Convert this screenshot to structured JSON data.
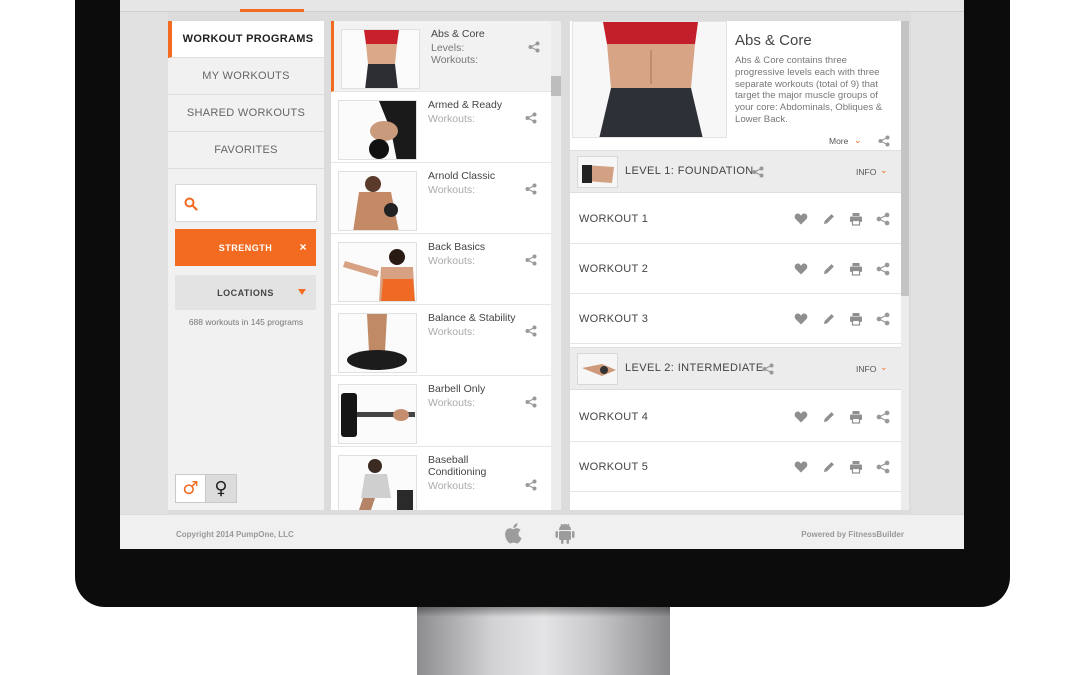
{
  "nav": {
    "items": [
      {
        "label": "WORKOUT PROGRAMS",
        "active": true
      },
      {
        "label": "MY WORKOUTS",
        "active": false
      },
      {
        "label": "SHARED WORKOUTS",
        "active": false
      },
      {
        "label": "FAVORITES",
        "active": false
      }
    ]
  },
  "filters": {
    "search_placeholder": "",
    "active_filter": "STRENGTH",
    "active_filter_close": "×",
    "locations_label": "LOCATIONS",
    "count_text": "688 workouts in 145 programs",
    "gender_male": "♂",
    "gender_female": "♀"
  },
  "programs": [
    {
      "title": "Abs & Core",
      "sub1": "Levels:",
      "sub2": "Workouts:",
      "selected": true
    },
    {
      "title": "Armed & Ready",
      "sub1": "Workouts:",
      "selected": false
    },
    {
      "title": "Arnold Classic",
      "sub1": "Workouts:",
      "selected": false
    },
    {
      "title": "Back Basics",
      "sub1": "Workouts:",
      "selected": false
    },
    {
      "title": "Balance & Stability",
      "sub1": "Workouts:",
      "selected": false
    },
    {
      "title": "Barbell Only",
      "sub1": "Workouts:",
      "selected": false
    },
    {
      "title": "Baseball Conditioning",
      "sub1": "Workouts:",
      "selected": false
    }
  ],
  "detail": {
    "title": "Abs & Core",
    "description": "Abs & Core contains three progressive levels each with three separate workouts (total of 9) that target the major muscle groups of your core: Abdominals, Obliques & Lower Back.",
    "more_label": "More",
    "levels": [
      {
        "label": "LEVEL 1: FOUNDATION",
        "info": "INFO",
        "workouts": [
          "WORKOUT 1",
          "WORKOUT 2",
          "WORKOUT 3"
        ]
      },
      {
        "label": "LEVEL 2: INTERMEDIATE",
        "info": "INFO",
        "workouts": [
          "WORKOUT 4",
          "WORKOUT 5"
        ]
      }
    ]
  },
  "footer": {
    "copyright": "Copyright 2014 PumpOne, LLC",
    "powered_by": "Powered by FitnessBuilder"
  },
  "colors": {
    "accent": "#f26b21",
    "bezel": "#0c0c0c"
  }
}
